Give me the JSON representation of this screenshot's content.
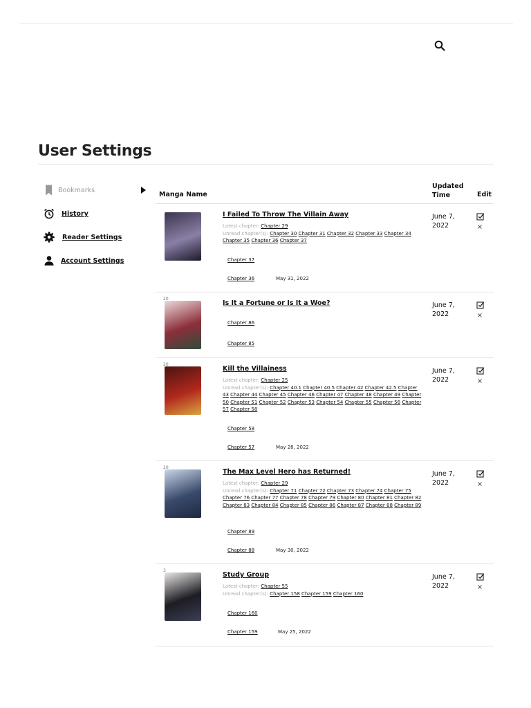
{
  "header": {
    "search_icon": "search-icon"
  },
  "page": {
    "title": "User Settings"
  },
  "sidebar": {
    "items": [
      {
        "label": "Bookmarks",
        "icon": "bookmark-icon"
      },
      {
        "label": "History",
        "icon": "alarm-clock-icon"
      },
      {
        "label": "Reader Settings",
        "icon": "gear-icon"
      },
      {
        "label": "Account Settings",
        "icon": "person-icon"
      }
    ]
  },
  "table": {
    "headers": {
      "name": "Manga Name",
      "time_line1": "Updated",
      "time_line2": "Time",
      "edit": "Edit"
    },
    "rows": [
      {
        "rank": "",
        "title": "I Failed To Throw The Villain Away",
        "latest_label": "Latest chapter:",
        "latest": "Chapter 29",
        "unread_label": "Unread chapter(s):",
        "unread": [
          "Chapter 30",
          "Chapter 31",
          "Chapter 32",
          "Chapter 33",
          "Chapter 34",
          "Chapter 35",
          "Chapter 36",
          "Chapter 37"
        ],
        "chap1": "Chapter 37",
        "chap2": "Chapter 36",
        "chap2_date": "May 31, 2022",
        "updated_line1": "June 7,",
        "updated_line2": "2022",
        "cover_colors": [
          "#3c3550",
          "#8a7fa6",
          "#1d1a2a"
        ]
      },
      {
        "rank": "20",
        "title": "Is It a Fortune or Is It a Woe?",
        "latest_label": "",
        "latest": "",
        "unread_label": "",
        "unread": [],
        "chap1": "Chapter 86",
        "chap2": "Chapter 85",
        "chap2_date": "",
        "updated_line1": "June 7,",
        "updated_line2": "2022",
        "cover_colors": [
          "#e9d8d8",
          "#8c2f3a",
          "#2f4c3c"
        ]
      },
      {
        "rank": "20",
        "title": "Kill the Villainess",
        "latest_label": "Latest chapter:",
        "latest": "Chapter 25",
        "unread_label": "Unread chapter(s):",
        "unread": [
          "Chapter 40.1",
          "Chapter 40.5",
          "Chapter 42",
          "Chapter 42.5",
          "Chapter 43",
          "Chapter 44",
          "Chapter 45",
          "Chapter 46",
          "Chapter 47",
          "Chapter 48",
          "Chapter 49",
          "Chapter 50",
          "Chapter 51",
          "Chapter 52",
          "Chapter 53",
          "Chapter 54",
          "Chapter 55",
          "Chapter 56",
          "Chapter 57",
          "Chapter 58"
        ],
        "chap1": "Chapter 58",
        "chap2": "Chapter 57",
        "chap2_date": "May 28, 2022",
        "updated_line1": "June 7,",
        "updated_line2": "2022",
        "cover_colors": [
          "#4a1410",
          "#b0281c",
          "#d9a441"
        ]
      },
      {
        "rank": "20",
        "title": "The Max Level Hero has Returned!",
        "latest_label": "Latest chapter:",
        "latest": "Chapter 29",
        "unread_label": "Unread chapter(s):",
        "unread": [
          "Chapter 71",
          "Chapter 72",
          "Chapter 73",
          "Chapter 74",
          "Chapter 75",
          "Chapter 76",
          "Chapter 77",
          "Chapter 78",
          "Chapter 79",
          "Chapter 80",
          "Chapter 81",
          "Chapter 82",
          "Chapter 83",
          "Chapter 84",
          "Chapter 85",
          "Chapter 86",
          "Chapter 87",
          "Chapter 88",
          "Chapter 89"
        ],
        "chap1": "Chapter 89",
        "chap2": "Chapter 88",
        "chap2_date": "May 30, 2022",
        "updated_line1": "June 7,",
        "updated_line2": "2022",
        "cover_colors": [
          "#c9d4e6",
          "#3a4a6c",
          "#1e2a40"
        ]
      },
      {
        "rank": "3",
        "title": "Study Group",
        "latest_label": "Latest chapter:",
        "latest": "Chapter 55",
        "unread_label": "Unread chapter(s):",
        "unread": [
          "Chapter 158",
          "Chapter 159",
          "Chapter 160"
        ],
        "chap1": "Chapter 160",
        "chap2": "Chapter 159",
        "chap2_date": "May 25, 2022",
        "updated_line1": "June 7,",
        "updated_line2": "2022",
        "cover_colors": [
          "#e9e6e3",
          "#1c1c22",
          "#3b3f55"
        ]
      }
    ]
  }
}
